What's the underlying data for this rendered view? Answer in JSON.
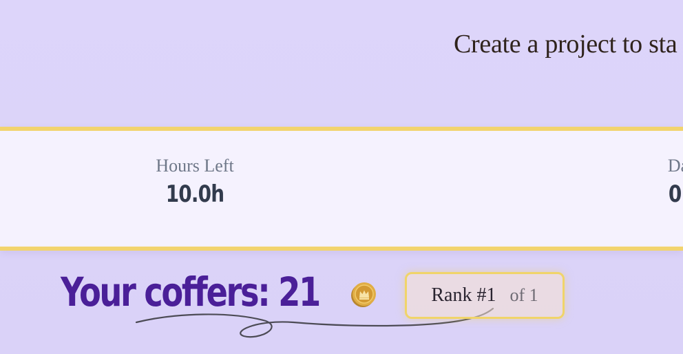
{
  "hero": {
    "message": "Create a project to sta"
  },
  "stats": {
    "hours_left": {
      "label": "Hours Left",
      "value": "10.0h"
    },
    "second": {
      "label": "Da",
      "value": "0."
    }
  },
  "coffers": {
    "label": "Your coffers: 21",
    "icon": "crown-coin-icon"
  },
  "rank": {
    "main": "Rank #1",
    "of": "of 1"
  },
  "colors": {
    "background": "#ddd5fa",
    "band": "#f5f2fe",
    "gold_border": "#f2d46e",
    "coffers_purple": "#4a1f98",
    "stat_text": "#323b4d"
  }
}
